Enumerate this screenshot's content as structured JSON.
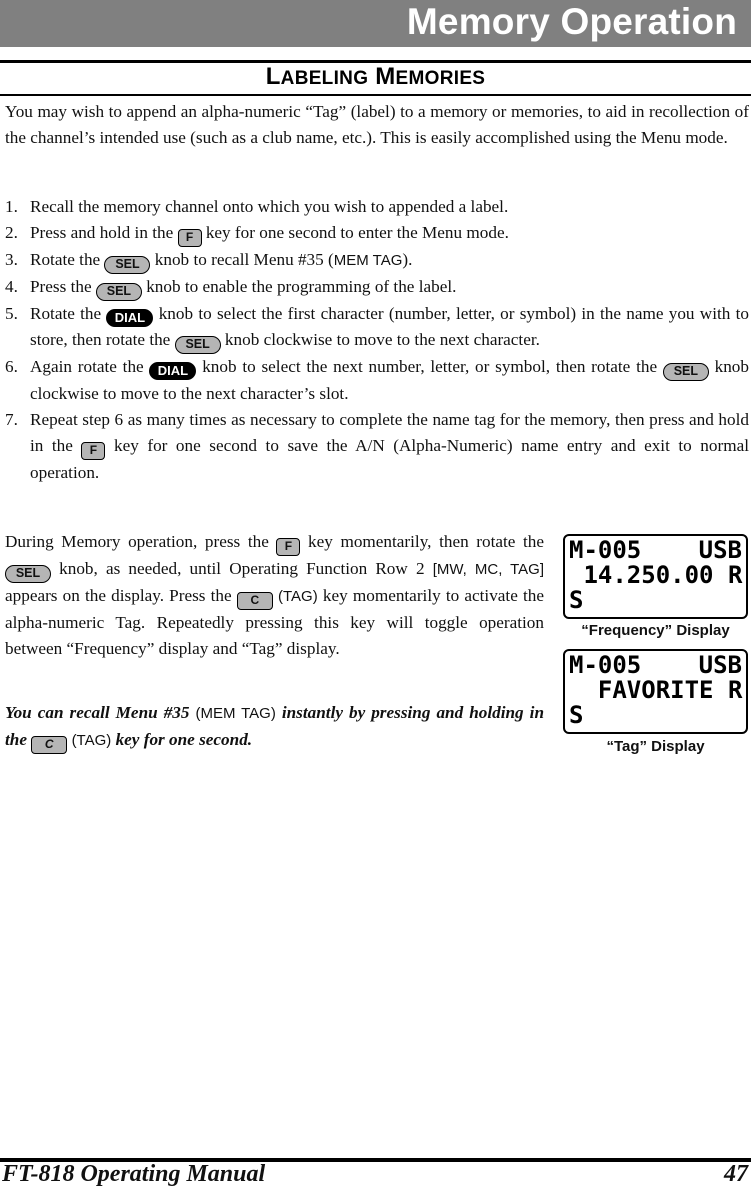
{
  "header": {
    "title": "Memory Operation"
  },
  "section": {
    "title_cap1": "L",
    "title_rest1": "ABELING",
    "title_cap2": "M",
    "title_rest2": "EMORIES"
  },
  "intro": "You may wish to append an alpha-numeric “Tag” (label) to a memory or memories, to aid in recollection of the channel’s intended use (such as a club name, etc.). This is easily accomplished using the Menu mode.",
  "keys": {
    "f": "F",
    "sel": "SEL",
    "dial": "DIAL",
    "c": "C"
  },
  "steps": [
    {
      "num": "1.",
      "parts": [
        "Recall the memory channel onto which you wish to appended a label."
      ]
    },
    {
      "num": "2.",
      "parts": [
        "Press and hold in the ",
        " key for one second to enter the Menu mode."
      ]
    },
    {
      "num": "3.",
      "parts": [
        "Rotate the ",
        " knob to recall Menu #35 (",
        "MEM TAG",
        ")."
      ]
    },
    {
      "num": "4.",
      "parts": [
        "Press the ",
        " knob to enable the programming of the label."
      ]
    },
    {
      "num": "5.",
      "parts": [
        "Rotate the ",
        " knob to select the first character (number, letter, or symbol) in the name you with to store, then rotate the ",
        " knob clockwise to move to the next character."
      ]
    },
    {
      "num": "6.",
      "parts": [
        "Again rotate the ",
        " knob to select the next number, letter, or symbol, then rotate the ",
        " knob clockwise to move to the next character’s slot."
      ]
    },
    {
      "num": "7.",
      "parts": [
        "Repeat step 6 as many times as necessary to complete the name tag for the memory, then press and hold in the ",
        " key for one second to save the A/N (Alpha-Numeric) name entry and exit to normal operation."
      ]
    }
  ],
  "para2": {
    "parts": [
      "During Memory operation, press the ",
      " key momentarily, then rotate the ",
      " knob, as needed, until Operating Function Row 2 ",
      "[MW, MC, TAG]",
      " appears on the display. Press the ",
      " ",
      "(TAG)",
      " key momentarily to activate the alpha-numeric Tag. Repeatedly pressing this key will toggle operation between “Frequency” display and “Tag” display."
    ]
  },
  "para3": {
    "parts": [
      "You can recall Menu #35 ",
      "(MEM TAG)",
      " instantly by pressing and holding in the ",
      " ",
      "(TAG)",
      " key for one second."
    ]
  },
  "displays": [
    {
      "row1_left": "M-005",
      "row1_right": "USB",
      "row2": " 14.250.00 R",
      "row3": "S",
      "caption": "“Frequency” Display"
    },
    {
      "row1_left": "M-005",
      "row1_right": "USB",
      "row2": "  FAVORITE R",
      "row3": "S",
      "caption": "“Tag” Display"
    }
  ],
  "footer": {
    "manual": "FT-818 Operating Manual",
    "page": "47"
  }
}
